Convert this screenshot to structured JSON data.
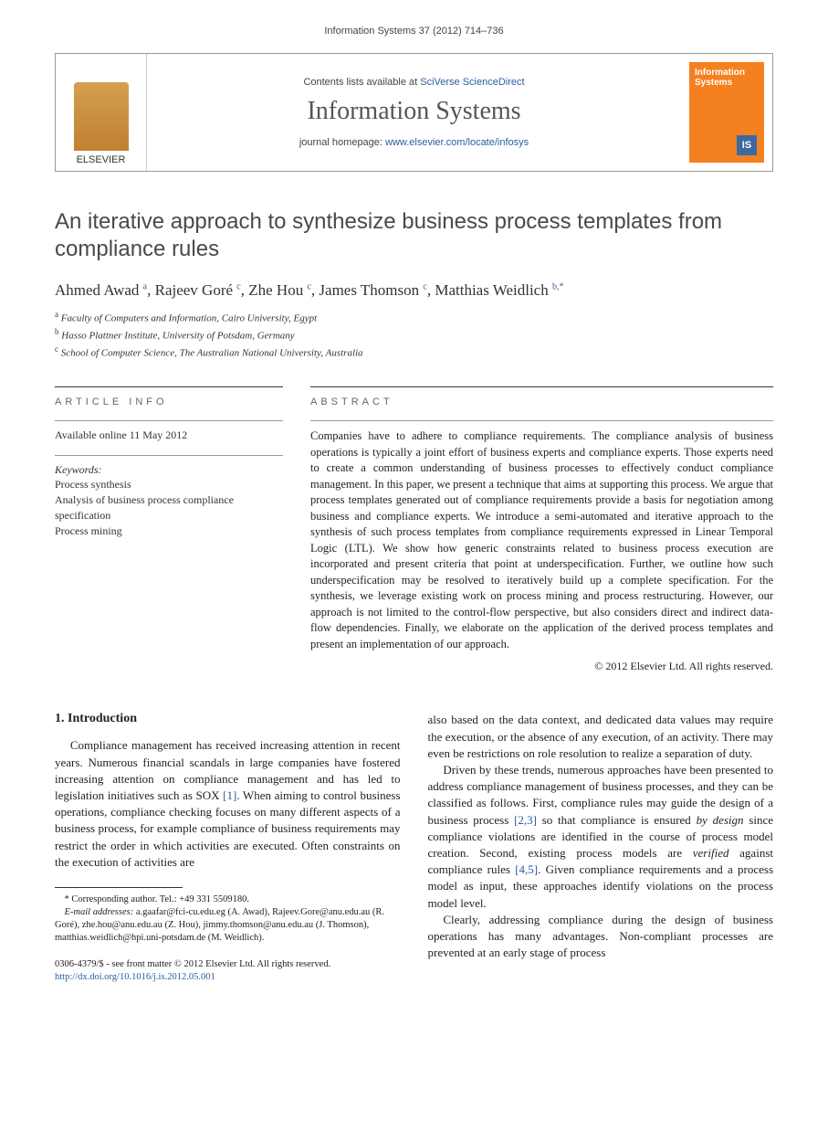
{
  "citation": "Information Systems 37 (2012) 714–736",
  "header": {
    "publisher_name": "ELSEVIER",
    "contents_prefix": "Contents lists available at ",
    "contents_link": "SciVerse ScienceDirect",
    "journal_name": "Information Systems",
    "homepage_prefix": "journal homepage: ",
    "homepage_url": "www.elsevier.com/locate/infosys",
    "cover_title": "Information Systems",
    "cover_badge": "IS"
  },
  "title": "An iterative approach to synthesize business process templates from compliance rules",
  "authors_html": "Ahmed Awad <sup>a</sup>, Rajeev Goré <sup>c</sup>, Zhe Hou <sup>c</sup>, James Thomson <sup>c</sup>, Matthias Weidlich <sup>b,*</sup>",
  "affiliations": [
    "a Faculty of Computers and Information, Cairo University, Egypt",
    "b Hasso Plattner Institute, University of Potsdam, Germany",
    "c School of Computer Science, The Australian National University, Australia"
  ],
  "article_info": {
    "label": "ARTICLE INFO",
    "availability": "Available online 11 May 2012",
    "keywords_label": "Keywords:",
    "keywords": [
      "Process synthesis",
      "Analysis of business process compliance specification",
      "Process mining"
    ]
  },
  "abstract": {
    "label": "ABSTRACT",
    "text": "Companies have to adhere to compliance requirements. The compliance analysis of business operations is typically a joint effort of business experts and compliance experts. Those experts need to create a common understanding of business processes to effectively conduct compliance management. In this paper, we present a technique that aims at supporting this process. We argue that process templates generated out of compliance requirements provide a basis for negotiation among business and compliance experts. We introduce a semi-automated and iterative approach to the synthesis of such process templates from compliance requirements expressed in Linear Temporal Logic (LTL). We show how generic constraints related to business process execution are incorporated and present criteria that point at underspecification. Further, we outline how such underspecification may be resolved to iteratively build up a complete specification. For the synthesis, we leverage existing work on process mining and process restructuring. However, our approach is not limited to the control-flow perspective, but also considers direct and indirect data-flow dependencies. Finally, we elaborate on the application of the derived process templates and present an implementation of our approach.",
    "copyright": "© 2012 Elsevier Ltd. All rights reserved."
  },
  "intro": {
    "heading": "1. Introduction",
    "p1_before_ref": "Compliance management has received increasing attention in recent years. Numerous financial scandals in large companies have fostered increasing attention on compliance management and has led to legislation initiatives such as SOX ",
    "p1_ref": "[1]",
    "p1_after_ref": ". When aiming to control business operations, compliance checking focuses on many different aspects of a business process, for example compliance of business requirements may restrict the order in which activities are executed. Often constraints on the execution of activities are",
    "p2": "also based on the data context, and dedicated data values may require the execution, or the absence of any execution, of an activity. There may even be restrictions on role resolution to realize a separation of duty.",
    "p3_a": "Driven by these trends, numerous approaches have been presented to address compliance management of business processes, and they can be classified as follows. First, compliance rules may guide the design of a business process ",
    "p3_ref1": "[2,3]",
    "p3_b": " so that compliance is ensured ",
    "p3_ital1": "by design",
    "p3_c": " since compliance violations are identified in the course of process model creation. Second, existing process models are ",
    "p3_ital2": "verified",
    "p3_d": " against compliance rules ",
    "p3_ref2": "[4,5]",
    "p3_e": ". Given compliance requirements and a process model as input, these approaches identify violations on the process model level.",
    "p4": "Clearly, addressing compliance during the design of business operations has many advantages. Non-compliant processes are prevented at an early stage of process"
  },
  "footnotes": {
    "corresponding": "* Corresponding author. Tel.: +49 331 5509180.",
    "emails_label": "E-mail addresses:",
    "emails": " a.gaafar@fci-cu.edu.eg (A. Awad), Rajeev.Gore@anu.edu.au (R. Goré), zhe.hou@anu.edu.au (Z. Hou), jimmy.thomson@anu.edu.au (J. Thomson), matthias.weidlich@hpi.uni-potsdam.de (M. Weidlich)."
  },
  "bottom": {
    "issn_line": "0306-4379/$ - see front matter © 2012 Elsevier Ltd. All rights reserved.",
    "doi_url": "http://dx.doi.org/10.1016/j.is.2012.05.001"
  }
}
